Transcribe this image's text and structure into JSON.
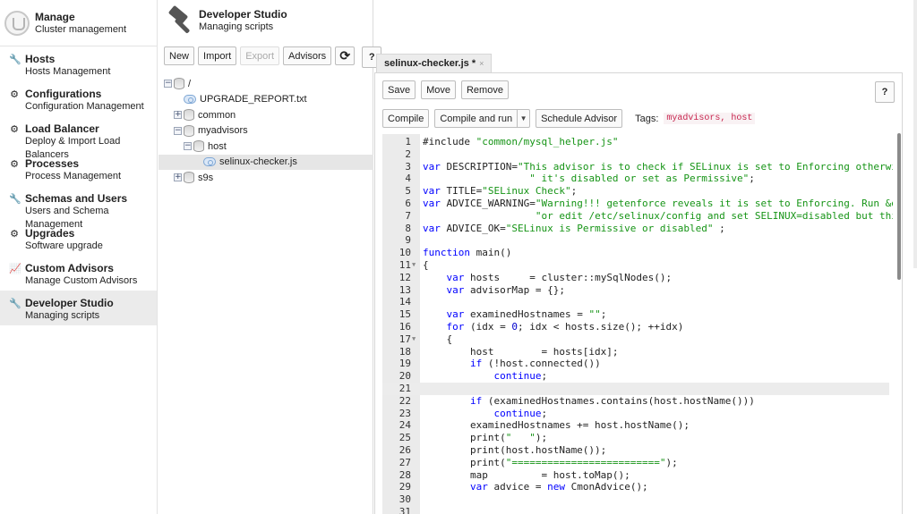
{
  "sidebar": {
    "header": {
      "title": "Manage",
      "subtitle": "Cluster management"
    },
    "items": [
      {
        "icon": "wrench-icon",
        "glyph": "🔧",
        "label": "Hosts",
        "sub": "Hosts Management"
      },
      {
        "icon": "gear-icon",
        "glyph": "⚙",
        "label": "Configurations",
        "sub": "Configuration Management"
      },
      {
        "icon": "gear-icon",
        "glyph": "⚙",
        "label": "Load Balancer",
        "sub": "Deploy & Import Load Balancers"
      },
      {
        "icon": "gear-icon",
        "glyph": "⚙",
        "label": "Processes",
        "sub": "Process Management"
      },
      {
        "icon": "wrench-icon",
        "glyph": "🔧",
        "label": "Schemas and Users",
        "sub": "Users and Schema Management"
      },
      {
        "icon": "gear-icon",
        "glyph": "⚙",
        "label": "Upgrades",
        "sub": "Software upgrade"
      },
      {
        "icon": "chart-icon",
        "glyph": "📈",
        "label": "Custom Advisors",
        "sub": "Manage Custom Advisors"
      },
      {
        "icon": "wrench-icon",
        "glyph": "🔧",
        "label": "Developer Studio",
        "sub": "Managing scripts"
      }
    ]
  },
  "studio": {
    "title": "Developer Studio",
    "subtitle": "Managing scripts",
    "toolbar": {
      "new": "New",
      "import": "Import",
      "export": "Export",
      "advisors": "Advisors",
      "refresh": "⟳",
      "help": "?"
    }
  },
  "tree": {
    "root": "/",
    "upgrade_report": "UPGRADE_REPORT.txt",
    "common": "common",
    "myadvisors": "myadvisors",
    "host": "host",
    "selinux": "selinux-checker.js",
    "s9s": "s9s"
  },
  "editor": {
    "tab_label": "selinux-checker.js *",
    "tab_close": "×",
    "save": "Save",
    "move": "Move",
    "remove": "Remove",
    "help": "?",
    "compile": "Compile",
    "compile_run": "Compile and run",
    "schedule": "Schedule Advisor",
    "tags_label": "Tags:",
    "tags": "myadvisors, host",
    "current_line": 21
  },
  "code": [
    {
      "n": "1",
      "t": [
        [
          "",
          "#include "
        ],
        [
          "str",
          "\"common/mysql_helper.js\""
        ]
      ]
    },
    {
      "n": "2",
      "t": []
    },
    {
      "n": "3",
      "t": [
        [
          "kw",
          "var"
        ],
        [
          "",
          " DESCRIPTION="
        ],
        [
          "str",
          "\"This advisor is to check if SELinux is set to Enforcing otherwise\""
        ]
      ]
    },
    {
      "n": "4",
      "t": [
        [
          "",
          "                  "
        ],
        [
          "str",
          "\" it's disabled or set as Permissive\""
        ],
        [
          "",
          ";"
        ]
      ]
    },
    {
      "n": "5",
      "t": [
        [
          "kw",
          "var"
        ],
        [
          "",
          " TITLE="
        ],
        [
          "str",
          "\"SELinux Check\""
        ],
        [
          "",
          ";"
        ]
      ]
    },
    {
      "n": "6",
      "t": [
        [
          "kw",
          "var"
        ],
        [
          "",
          " ADVICE_WARNING="
        ],
        [
          "str",
          "\"Warning!!! getenforce reveals it is set to Enforcing. Run &quot"
        ]
      ]
    },
    {
      "n": "7",
      "t": [
        [
          "",
          "                   "
        ],
        [
          "str",
          "\"or edit /etc/selinux/config and set SELINUX=disabled but this r"
        ]
      ]
    },
    {
      "n": "8",
      "t": [
        [
          "kw",
          "var"
        ],
        [
          "",
          " ADVICE_OK="
        ],
        [
          "str",
          "\"SELinux is Permissive or disabled\""
        ],
        [
          "",
          " ;"
        ]
      ]
    },
    {
      "n": "9",
      "t": []
    },
    {
      "n": "10",
      "t": [
        [
          "kw",
          "function"
        ],
        [
          "",
          " main()"
        ]
      ]
    },
    {
      "n": "11",
      "fold": true,
      "t": [
        [
          "",
          "{"
        ]
      ]
    },
    {
      "n": "12",
      "t": [
        [
          "",
          "    "
        ],
        [
          "kw",
          "var"
        ],
        [
          "",
          " hosts     = cluster::mySqlNodes();"
        ]
      ]
    },
    {
      "n": "13",
      "t": [
        [
          "",
          "    "
        ],
        [
          "kw",
          "var"
        ],
        [
          "",
          " advisorMap = {};"
        ]
      ]
    },
    {
      "n": "14",
      "t": []
    },
    {
      "n": "15",
      "t": [
        [
          "",
          "    "
        ],
        [
          "kw",
          "var"
        ],
        [
          "",
          " examinedHostnames = "
        ],
        [
          "str",
          "\"\""
        ],
        [
          "",
          ";"
        ]
      ]
    },
    {
      "n": "16",
      "t": [
        [
          "",
          "    "
        ],
        [
          "kw",
          "for"
        ],
        [
          "",
          " (idx = "
        ],
        [
          "num",
          "0"
        ],
        [
          "",
          "; idx < hosts.size(); ++idx)"
        ]
      ]
    },
    {
      "n": "17",
      "fold": true,
      "t": [
        [
          "",
          "    {"
        ]
      ]
    },
    {
      "n": "18",
      "t": [
        [
          "",
          "        host        = hosts[idx];"
        ]
      ]
    },
    {
      "n": "19",
      "t": [
        [
          "",
          "        "
        ],
        [
          "kw",
          "if"
        ],
        [
          "",
          " (!host.connected())"
        ]
      ]
    },
    {
      "n": "20",
      "t": [
        [
          "",
          "            "
        ],
        [
          "kw",
          "continue"
        ],
        [
          "",
          ";"
        ]
      ]
    },
    {
      "n": "21",
      "t": []
    },
    {
      "n": "22",
      "t": [
        [
          "",
          "        "
        ],
        [
          "kw",
          "if"
        ],
        [
          "",
          " (examinedHostnames.contains(host.hostName()))"
        ]
      ]
    },
    {
      "n": "23",
      "t": [
        [
          "",
          "            "
        ],
        [
          "kw",
          "continue"
        ],
        [
          "",
          ";"
        ]
      ]
    },
    {
      "n": "24",
      "t": [
        [
          "",
          "        examinedHostnames += host.hostName();"
        ]
      ]
    },
    {
      "n": "25",
      "t": [
        [
          "",
          "        print("
        ],
        [
          "str",
          "\"   \""
        ],
        [
          "",
          ");"
        ]
      ]
    },
    {
      "n": "26",
      "t": [
        [
          "",
          "        print(host.hostName());"
        ]
      ]
    },
    {
      "n": "27",
      "t": [
        [
          "",
          "        print("
        ],
        [
          "str",
          "\"=========================\""
        ],
        [
          "",
          ");"
        ]
      ]
    },
    {
      "n": "28",
      "t": [
        [
          "",
          "        map         = host.toMap();"
        ]
      ]
    },
    {
      "n": "29",
      "t": [
        [
          "",
          "        "
        ],
        [
          "kw",
          "var"
        ],
        [
          "",
          " advice = "
        ],
        [
          "kw",
          "new"
        ],
        [
          "",
          " CmonAdvice();"
        ]
      ]
    },
    {
      "n": "30",
      "t": []
    },
    {
      "n": "31",
      "t": []
    }
  ]
}
